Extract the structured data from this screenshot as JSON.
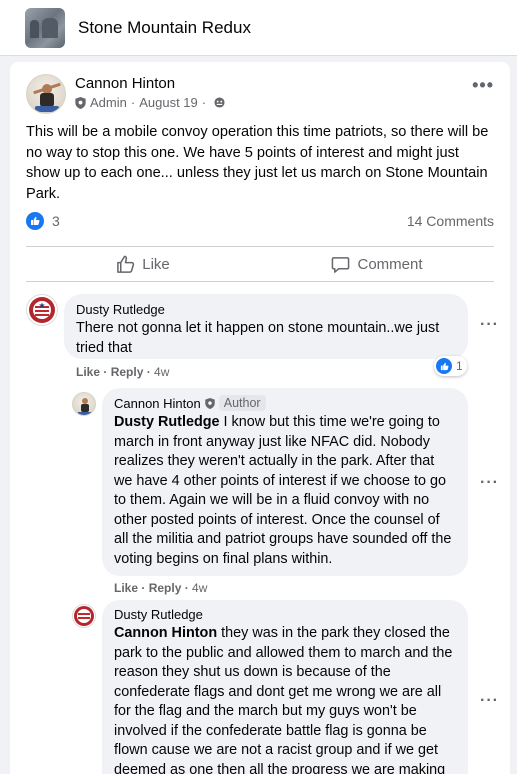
{
  "group": {
    "title": "Stone Mountain Redux"
  },
  "post": {
    "author": "Cannon Hinton",
    "role": "Admin",
    "date": "August 19",
    "text": "This will be a mobile convoy operation this time patriots, so there will be no way to stop this one. We have 5 points of interest and might just show up to each one... unless they just let us march on Stone Mountain Park.",
    "reaction_count": "3",
    "comment_count": "14 Comments",
    "like_label": "Like",
    "comment_label": "Comment"
  },
  "comments": [
    {
      "author": "Dusty Rutledge",
      "text": "There not gonna let it happen on stone mountain..we just tried that",
      "like_label": "Like",
      "reply_label": "Reply",
      "time": "4w",
      "reaction_count": "1"
    },
    {
      "author": "Cannon Hinton",
      "badge": "Author",
      "mention": "Dusty Rutledge",
      "text": " I know but this time we're going to march in front anyway just like NFAC did. Nobody realizes they weren't actually in the park. After that we have 4 other points of interest if we choose to go to them. Again we will be in a fluid convoy with no other posted points of interest. Once the counsel of all the militia and patriot groups have sounded off the voting begins on final plans within.",
      "like_label": "Like",
      "reply_label": "Reply",
      "time": "4w"
    },
    {
      "author": "Dusty Rutledge",
      "mention": "Cannon Hinton",
      "text": " they was in the park they closed the park to the public and allowed them to march and the reason they shut us down is because of the confederate flags and dont get me wrong we are all for the flag and the march but my guys won't be involved if the confederate battle flag is gonna be flown cause we are not a racist group and if we get deemed as one then all the progress we are making"
    }
  ],
  "colors": {
    "accent": "#1877f2",
    "background": "#f0f2f5",
    "bubble": "#f0f2f5",
    "secondary_text": "#65676b"
  }
}
